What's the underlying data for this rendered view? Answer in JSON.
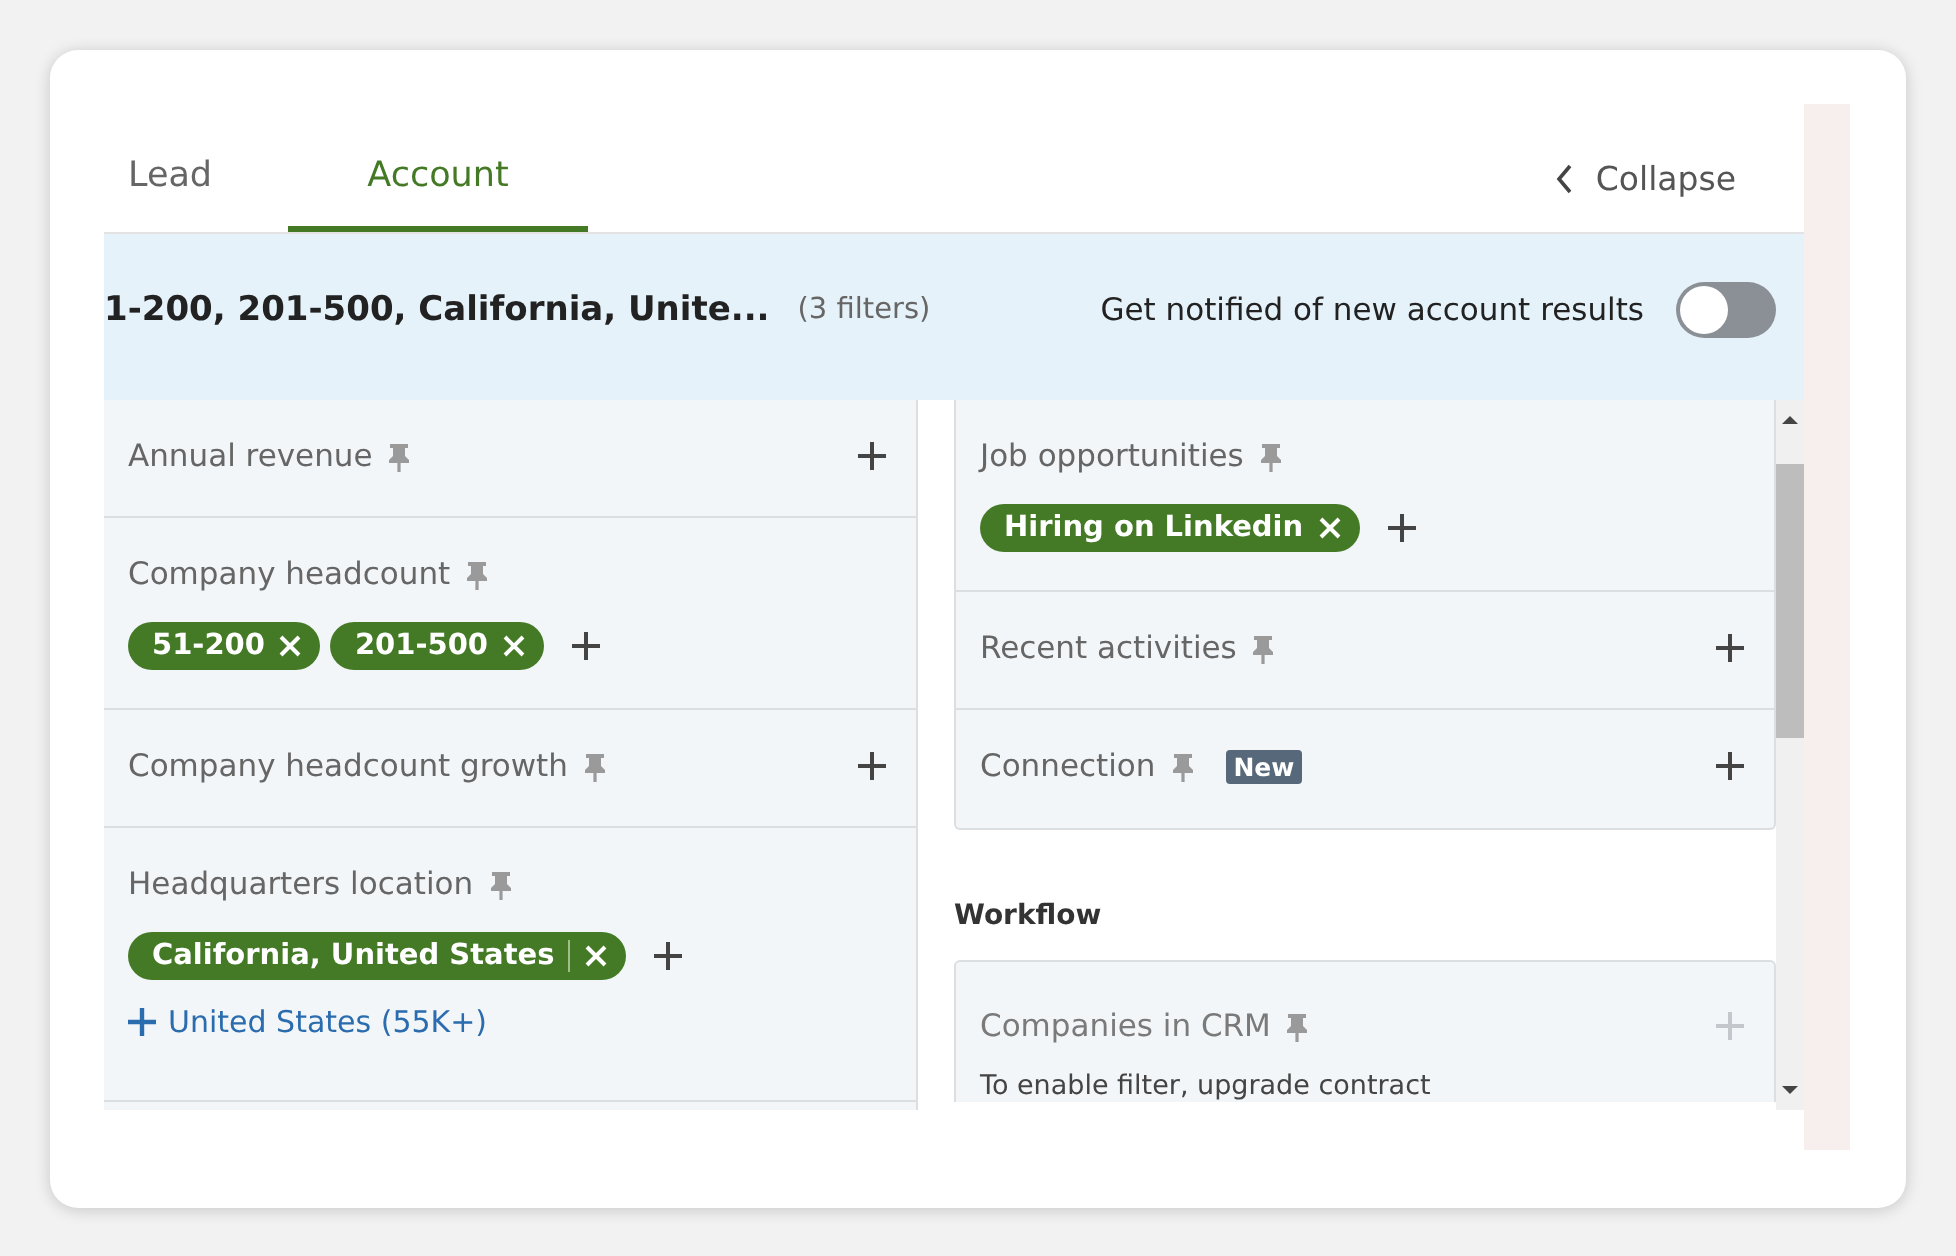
{
  "tabs": [
    {
      "label": "Lead",
      "selected": false
    },
    {
      "label": "Account",
      "selected": true
    }
  ],
  "collapse": {
    "label": "Collapse"
  },
  "banner": {
    "summary": "1-200, 201-500, California, Unite...",
    "count": "(3 filters)",
    "notify_label": "Get notified of new account results",
    "notify_on": false
  },
  "left_filters": [
    {
      "label": "Annual revenue"
    },
    {
      "label": "Company headcount",
      "chips": [
        "51-200",
        "201-500"
      ]
    },
    {
      "label": "Company headcount growth"
    },
    {
      "label": "Headquarters location",
      "chips": [
        "California, United States"
      ],
      "suggestion": "United States (55K+)"
    }
  ],
  "right_filters": [
    {
      "label": "Job opportunities",
      "chips": [
        "Hiring on Linkedin"
      ]
    },
    {
      "label": "Recent activities"
    },
    {
      "label": "Connection",
      "badge": "New"
    }
  ],
  "workflow": {
    "title": "Workflow",
    "filters": [
      {
        "label": "Companies in CRM",
        "disabled": true,
        "note": "To enable filter, upgrade contract"
      }
    ]
  }
}
